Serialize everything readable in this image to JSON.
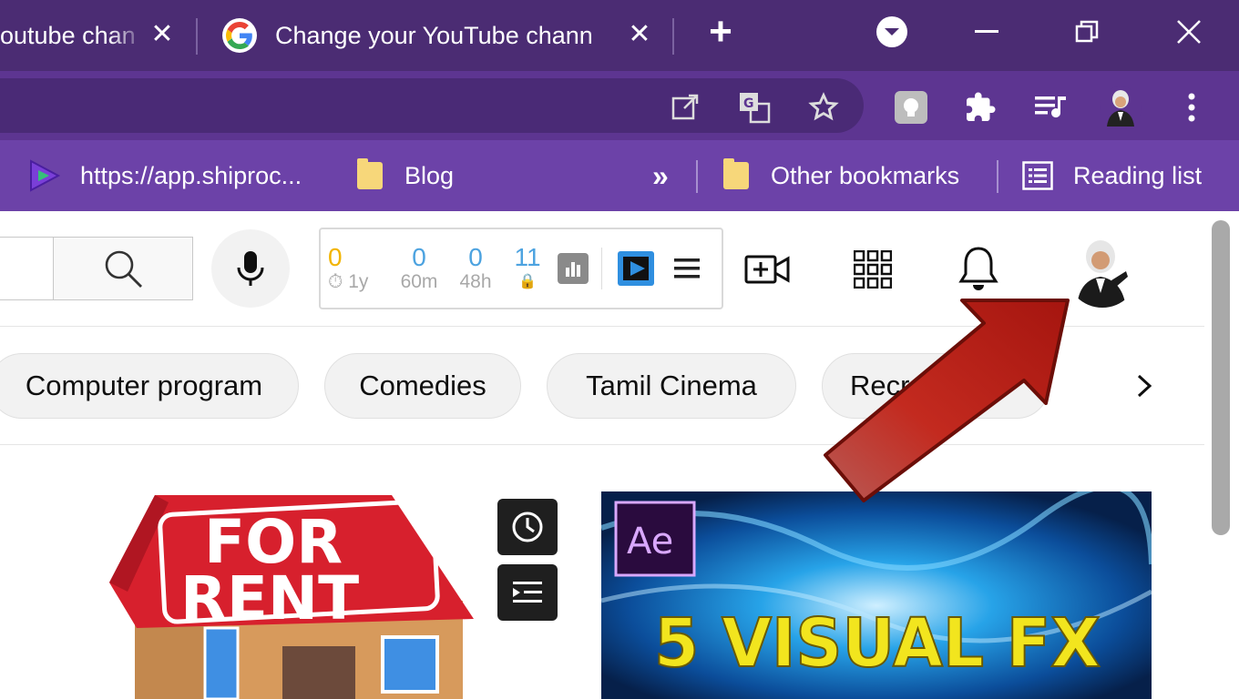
{
  "tabs": [
    {
      "title": "outube chan",
      "close_label": "✕"
    },
    {
      "title": "Change your YouTube chann",
      "close_label": "✕"
    }
  ],
  "new_tab_label": "+",
  "window_controls": {
    "minimize": "—",
    "close": "✕"
  },
  "toolbar_icons": [
    "open-in-new-icon",
    "translate-icon",
    "star-icon",
    "extension-bulb-icon",
    "puzzle-extensions-icon",
    "media-queue-icon",
    "profile-avatar-icon",
    "kebab-menu-icon"
  ],
  "bookmarks": {
    "items": [
      {
        "label": "https://app.shiproc..."
      },
      {
        "label": "Blog"
      }
    ],
    "overflow_label": "»",
    "other_bookmarks": "Other bookmarks",
    "reading_list": "Reading list"
  },
  "extension_stats": [
    {
      "value": "0",
      "label": "⏱ 1y",
      "color": "#f2b400"
    },
    {
      "value": "0",
      "label": "60m",
      "color": "#4da3e0"
    },
    {
      "value": "0",
      "label": "48h",
      "color": "#4da3e0"
    },
    {
      "value": "11",
      "label": "🔒",
      "color": "#4da3e0"
    }
  ],
  "chips": [
    {
      "label": "Computer program"
    },
    {
      "label": "Comedies"
    },
    {
      "label": "Tamil Cinema"
    },
    {
      "label": "Recr"
    }
  ],
  "videos": [
    {
      "thumb_text_line1": "FOR",
      "thumb_text_line2": "RENT"
    },
    {
      "badge": "Ae",
      "thumb_text": "5 VISUAL FX"
    }
  ],
  "colors": {
    "tabbar": "#4b2c73",
    "toolbar": "#5d3591",
    "bookmarks_bar": "#6c42a8",
    "arrow": "#c3271b"
  }
}
